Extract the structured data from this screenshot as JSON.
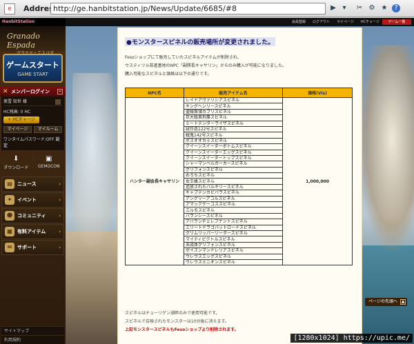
{
  "browser": {
    "address_label": "Address:",
    "url": "http://ge.hanbitstation.jp/News/Update/6685/#8"
  },
  "site": {
    "logo": "HanbitStation",
    "topnav": [
      "会員登録",
      "ログアウト",
      "マイページ",
      "HCチャージ"
    ],
    "game_start_top": "ゲーム一覧"
  },
  "sidebar": {
    "game_logo": "Granado Espada",
    "game_logo_sub": "グラナド・エスパダ",
    "start_jp": "ゲームスタート",
    "start_en": "GAME START",
    "member_login": "メンバーログイン",
    "user_name": "美雪 知世 様",
    "hc_points": "HC残高: 0 HC",
    "hc_charge": "+ HCチャージ",
    "mypage": "マイページ",
    "mymail": "マイルーム",
    "otp": "ワンタイムパスワード:OFF",
    "otp_set": "設定",
    "download": "ダウンロード",
    "gemocon": "GEMOCON",
    "menu": [
      "ニュース",
      "イベント",
      "コミュニティ",
      "有料アイテム",
      "サポート"
    ],
    "footer": [
      "サイトマップ",
      "利用規約"
    ]
  },
  "article": {
    "title": "●モンスタースピネルの販売場所が変更されました。",
    "para1": "Fesoショップにて販売していたスピネルアイテムが削除され、",
    "para2": "ウスティツル前進基地のNPC「副隊長キャサリン」からのみ購入が可能になりました。",
    "para3": "購入可能なスピネルと価格は以下の通りです。",
    "table": {
      "headers": [
        "NPC名",
        "販売アイテム名",
        "価格(Vis)"
      ],
      "npc": "ハンター副会長キャサリン",
      "price": "1,000,000",
      "items": [
        "レイドアヴァリシアスピネル",
        "キングヘンリースピネル",
        "盗賊首領カプリスピネル",
        "巨大殺首刑事スピネル",
        "ミートテンダーライザスピネル",
        "試作品122号スピネル",
        "戦鬼142号スピネル",
        "ボスオオカミスピネル",
        "クイーンスイーターボトムスピネル",
        "クイーンスイーターエッグスピネル",
        "クイーンスイータートップスピネル",
        "シャーマンベルガーカースピネル",
        "グリフォンスピネル",
        "おろちスピネル",
        "女王蜂スピネル",
        "追放されたバルギリースピネル",
        "キャプテンカピバラスピネル",
        "アングリーアコルスピネル",
        "アマックゲーコススピネル",
        "エルモスピネル",
        "バランシースピネル",
        "アバランチェレブナントスピネル",
        "エリートドラゴバットロードスピネル",
        "グリムリッパーリーダースピネル",
        "マイティピクトルスピネル",
        "未成体グリフォンスピネル",
        "ポイズンマンドレリアスピネル",
        "ウレウスエッグスピネル",
        "ウレウスミニオンスピネル"
      ]
    },
    "note1": "スピネルはチューリゲン湖畔のみで使用可能です。",
    "note2": "スピネルで召喚されたモンスターは10分後に消えます。",
    "note3": "上記モンスタースピネルもFesoショップより削除されます。"
  },
  "to_top": "ページの先頭へ",
  "watermark": "[1280x1024] https://upic.me/"
}
